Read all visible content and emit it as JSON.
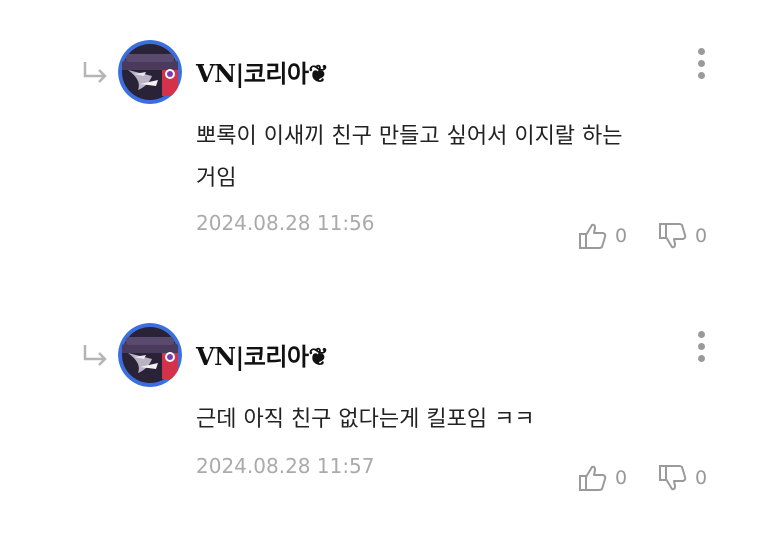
{
  "comments": [
    {
      "username": "VN|코리아❦",
      "text": "뽀록이 이새끼 친구 만들고 싶어서 이지랄 하는\n거임",
      "timestamp": "2024.08.28 11:56",
      "likes": "0",
      "dislikes": "0"
    },
    {
      "username": "VN|코리아❦",
      "text": "근데 아직 친구 없다는게 킬포임 ㅋㅋ",
      "timestamp": "2024.08.28 11:57",
      "likes": "0",
      "dislikes": "0"
    }
  ],
  "icons": {
    "reply": "reply-arrow-icon",
    "more": "more-vertical-icon",
    "like": "thumbs-up-icon",
    "dislike": "thumbs-down-icon"
  },
  "colors": {
    "muted_text": "#aaaaaa",
    "icon_gray": "#9a9a9a",
    "avatar_ring": "#3b6fe0"
  }
}
